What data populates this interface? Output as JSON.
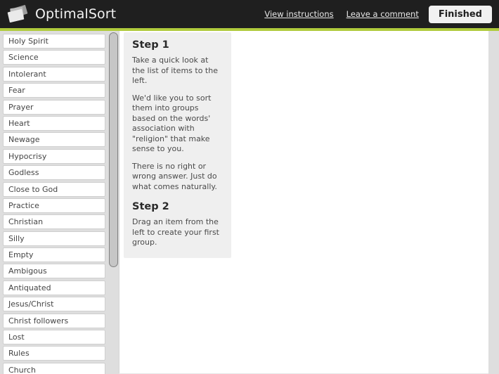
{
  "header": {
    "brand_name": "OptimalSort",
    "logo_icon": "stacked-cards-icon",
    "links": [
      {
        "label": "View instructions",
        "name": "view-instructions-link"
      },
      {
        "label": "Leave a comment",
        "name": "leave-a-comment-link"
      }
    ],
    "finished_label": "Finished",
    "background_color": "#1f1f1f",
    "accent_color": "#b0cb3d"
  },
  "sidebar": {
    "background_color": "#dedede",
    "items": [
      "Holy Spirit",
      "Science",
      "Intolerant",
      "Fear",
      "Prayer",
      "Heart",
      "Newage",
      "Hypocrisy",
      "Godless",
      "Close to God",
      "Practice",
      "Christian",
      "Silly",
      "Empty",
      "Ambigous",
      "Antiquated",
      "Jesus/Christ",
      "Christ followers",
      "Lost",
      "Rules",
      "Church"
    ],
    "scrollbar": "vertical-scrollbar"
  },
  "instructions": {
    "step1_title": "Step 1",
    "step1_paragraphs": [
      "Take a quick look at the list of items to the left.",
      "We'd like you to sort them into groups based on the words' association with \"religion\" that make sense to you.",
      "There is no right or wrong answer. Just do what comes naturally."
    ],
    "step2_title": "Step 2",
    "step2_paragraphs": [
      "Drag an item from the left to create your first group."
    ],
    "panel_color": "#efefef"
  }
}
